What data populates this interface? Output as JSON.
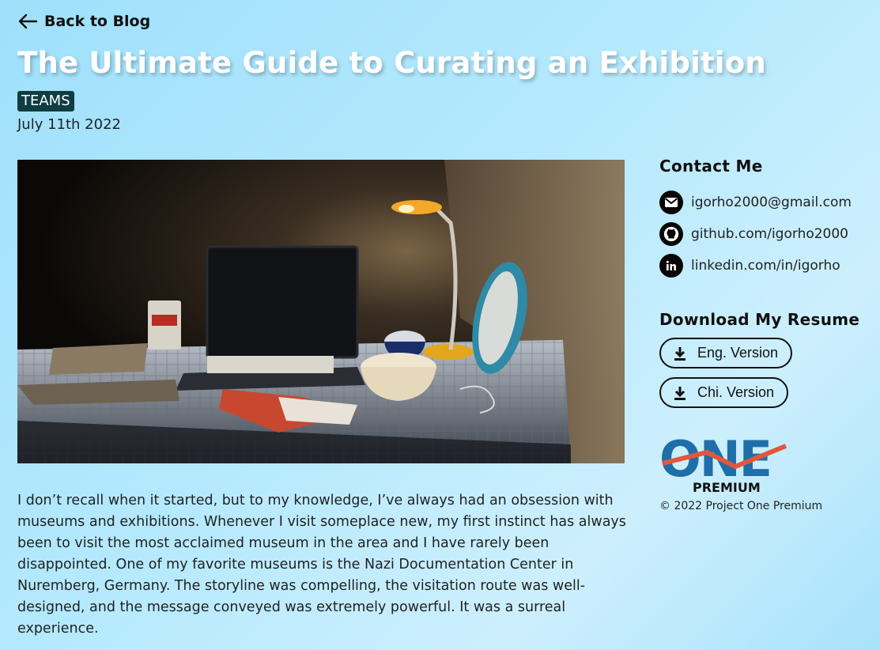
{
  "nav": {
    "back_label": "Back to Blog"
  },
  "article": {
    "title": "The Ultimate Guide to Curating an Exhibition",
    "tag": "TEAMS",
    "date": "July 11th 2022",
    "paragraph": "I don’t recall when it started, but to my knowledge, I’ve always had an obsession with museums and exhibitions. Whenever I visit someplace new, my first instinct has always been to visit the most acclaimed museum in the area and I have rarely been disappointed. One of my favorite museums is the Nazi Documentation Center in Nuremberg, Germany. The storyline was compelling, the visitation route was well-designed, and the message conveyed was extremely powerful. It was a surreal experience."
  },
  "sidebar": {
    "contact_heading": "Contact Me",
    "contacts": [
      {
        "icon": "email-icon",
        "label": "igorho2000@gmail.com"
      },
      {
        "icon": "github-icon",
        "label": "github.com/igorho2000"
      },
      {
        "icon": "linkedin-icon",
        "label": "linkedin.com/in/igorho"
      }
    ],
    "resume_heading": "Download My Resume",
    "resume_buttons": [
      {
        "icon": "download-icon",
        "label": "Eng. Version"
      },
      {
        "icon": "download-icon",
        "label": "Chi. Version"
      }
    ],
    "logo": {
      "main": "ONE",
      "sub": "PREMIUM"
    },
    "copyright": "© 2022 Project One Premium"
  },
  "colors": {
    "tag_bg": "#0e3d42",
    "logo_blue": "#1e6fa8",
    "logo_orange": "#e2573a"
  }
}
